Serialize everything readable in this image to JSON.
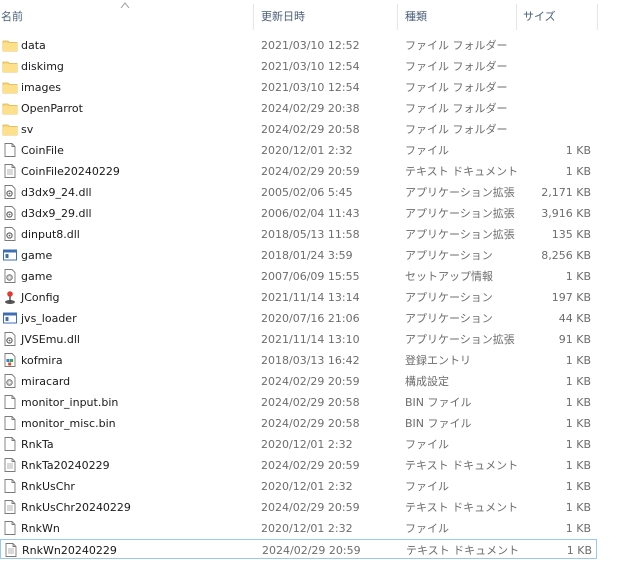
{
  "columns": {
    "name": "名前",
    "date": "更新日時",
    "type": "種類",
    "size": "サイズ"
  },
  "files": [
    {
      "name": "data",
      "date": "2021/03/10 12:52",
      "type": "ファイル フォルダー",
      "size": "",
      "icon": "folder-icon"
    },
    {
      "name": "diskimg",
      "date": "2021/03/10 12:54",
      "type": "ファイル フォルダー",
      "size": "",
      "icon": "folder-icon"
    },
    {
      "name": "images",
      "date": "2021/03/10 12:54",
      "type": "ファイル フォルダー",
      "size": "",
      "icon": "folder-icon"
    },
    {
      "name": "OpenParrot",
      "date": "2024/02/29 20:38",
      "type": "ファイル フォルダー",
      "size": "",
      "icon": "folder-icon"
    },
    {
      "name": "sv",
      "date": "2024/02/29 20:58",
      "type": "ファイル フォルダー",
      "size": "",
      "icon": "folder-icon"
    },
    {
      "name": "CoinFile",
      "date": "2020/12/01 2:32",
      "type": "ファイル",
      "size": "1 KB",
      "icon": "blank-file-icon"
    },
    {
      "name": "CoinFile20240229",
      "date": "2024/02/29 20:59",
      "type": "テキスト ドキュメント",
      "size": "1 KB",
      "icon": "text-file-icon"
    },
    {
      "name": "d3dx9_24.dll",
      "date": "2005/02/06 5:45",
      "type": "アプリケーション拡張",
      "size": "2,171 KB",
      "icon": "dll-file-icon"
    },
    {
      "name": "d3dx9_29.dll",
      "date": "2006/02/04 11:43",
      "type": "アプリケーション拡張",
      "size": "3,916 KB",
      "icon": "dll-file-icon"
    },
    {
      "name": "dinput8.dll",
      "date": "2018/05/13 11:58",
      "type": "アプリケーション拡張",
      "size": "135 KB",
      "icon": "dll-file-icon"
    },
    {
      "name": "game",
      "date": "2018/01/24 3:59",
      "type": "アプリケーション",
      "size": "8,256 KB",
      "icon": "app-window-icon"
    },
    {
      "name": "game",
      "date": "2007/06/09 15:55",
      "type": "セットアップ情報",
      "size": "1 KB",
      "icon": "settings-file-icon"
    },
    {
      "name": "JConfig",
      "date": "2021/11/14 13:14",
      "type": "アプリケーション",
      "size": "197 KB",
      "icon": "joystick-icon"
    },
    {
      "name": "jvs_loader",
      "date": "2020/07/16 21:06",
      "type": "アプリケーション",
      "size": "44 KB",
      "icon": "app-window-icon"
    },
    {
      "name": "JVSEmu.dll",
      "date": "2021/11/14 13:10",
      "type": "アプリケーション拡張",
      "size": "91 KB",
      "icon": "dll-file-icon"
    },
    {
      "name": "kofmira",
      "date": "2018/03/13 16:42",
      "type": "登録エントリ",
      "size": "1 KB",
      "icon": "registry-file-icon"
    },
    {
      "name": "miracard",
      "date": "2024/02/29 20:59",
      "type": "構成設定",
      "size": "1 KB",
      "icon": "settings-file-icon"
    },
    {
      "name": "monitor_input.bin",
      "date": "2024/02/29 20:58",
      "type": "BIN ファイル",
      "size": "1 KB",
      "icon": "blank-file-icon"
    },
    {
      "name": "monitor_misc.bin",
      "date": "2024/02/29 20:58",
      "type": "BIN ファイル",
      "size": "1 KB",
      "icon": "blank-file-icon"
    },
    {
      "name": "RnkTa",
      "date": "2020/12/01 2:32",
      "type": "ファイル",
      "size": "1 KB",
      "icon": "blank-file-icon"
    },
    {
      "name": "RnkTa20240229",
      "date": "2024/02/29 20:59",
      "type": "テキスト ドキュメント",
      "size": "1 KB",
      "icon": "text-file-icon"
    },
    {
      "name": "RnkUsChr",
      "date": "2020/12/01 2:32",
      "type": "ファイル",
      "size": "1 KB",
      "icon": "blank-file-icon"
    },
    {
      "name": "RnkUsChr20240229",
      "date": "2024/02/29 20:59",
      "type": "テキスト ドキュメント",
      "size": "1 KB",
      "icon": "text-file-icon"
    },
    {
      "name": "RnkWn",
      "date": "2020/12/01 2:32",
      "type": "ファイル",
      "size": "1 KB",
      "icon": "blank-file-icon"
    },
    {
      "name": "RnkWn20240229",
      "date": "2024/02/29 20:59",
      "type": "テキスト ドキュメント",
      "size": "1 KB",
      "icon": "text-file-icon",
      "focused": true
    }
  ],
  "colors": {
    "folder": "#f8d775",
    "header_text": "#4c607a",
    "focus_border": "#99c9ef"
  }
}
